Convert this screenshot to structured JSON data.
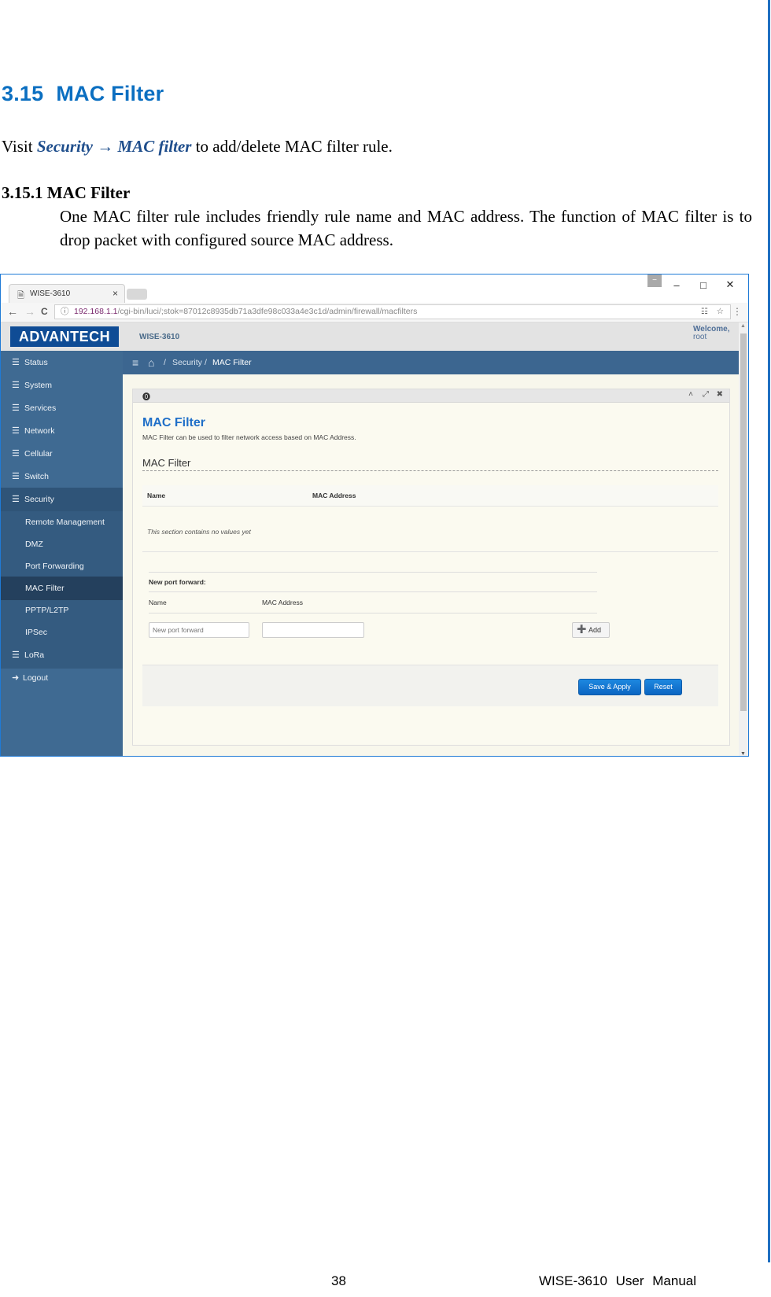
{
  "doc": {
    "section_number": "3.15",
    "section_title": "MAC Filter",
    "visit_prefix": "Visit ",
    "visit_security": "Security",
    "visit_arrow": " →",
    "visit_macfilter": "MAC filter",
    "visit_suffix": " to add/delete MAC filter rule.",
    "subsection": "3.15.1 MAC Filter",
    "paragraph": "One MAC filter rule includes friendly rule name and MAC address. The function of MAC filter is to drop packet with configured source MAC address.",
    "page_number": "38",
    "footer_title": "WISE-3610 User Manual",
    "accent_color": "#0b6fc1"
  },
  "browser": {
    "tab_title": "WISE-3610",
    "tab_close": "×",
    "url_host": "192.168.1.1",
    "url_path": "/cgi-bin/luci/;stok=87012c8935db71a3dfe98c033a4e3c1d/admin/firewall/macfilters",
    "window_minimize": "–",
    "window_maximize": "□",
    "window_close": "✕",
    "back": "←",
    "forward": "→",
    "reload": "C",
    "info": "ⓘ",
    "translate": "☷",
    "star": "☆",
    "menu": "⋮",
    "profile": "−"
  },
  "app": {
    "logo": "ADVANTECH",
    "model": "WISE-3610",
    "welcome": "Welcome,",
    "user": "root",
    "sidebar": [
      {
        "label": "Status",
        "icon": "☰"
      },
      {
        "label": "System",
        "icon": "☰"
      },
      {
        "label": "Services",
        "icon": "☰"
      },
      {
        "label": "Network",
        "icon": "☰"
      },
      {
        "label": "Cellular",
        "icon": "☰"
      },
      {
        "label": "Switch",
        "icon": "☰"
      },
      {
        "label": "Security",
        "icon": "☰"
      },
      {
        "label": "Remote Management"
      },
      {
        "label": "DMZ"
      },
      {
        "label": "Port Forwarding"
      },
      {
        "label": "MAC Filter"
      },
      {
        "label": "PPTP/L2TP"
      },
      {
        "label": "IPSec"
      },
      {
        "label": "LoRa",
        "icon": "☰"
      },
      {
        "label": "Logout",
        "icon": "➜"
      }
    ],
    "breadcrumb": {
      "menu_icon": "≡",
      "home_icon": "⌂",
      "sep": "/",
      "parent": "Security",
      "current": "MAC Filter"
    },
    "panel": {
      "info_icon": "⓿",
      "collapse_icon": "˄",
      "expand_icon": "⤢",
      "close_icon": "✖",
      "title": "MAC Filter",
      "description": "MAC Filter can be used to filter network access based on MAC Address.",
      "section_title": "MAC Filter",
      "columns": [
        "Name",
        "MAC Address"
      ],
      "empty_text": "This section contains no values yet",
      "new_header": "New port forward:",
      "new_columns": [
        "Name",
        "MAC Address"
      ],
      "name_placeholder": "New port forward",
      "mac_value": "",
      "add_label": "Add",
      "add_icon": "➕",
      "save_label": "Save & Apply",
      "reset_label": "Reset"
    }
  }
}
